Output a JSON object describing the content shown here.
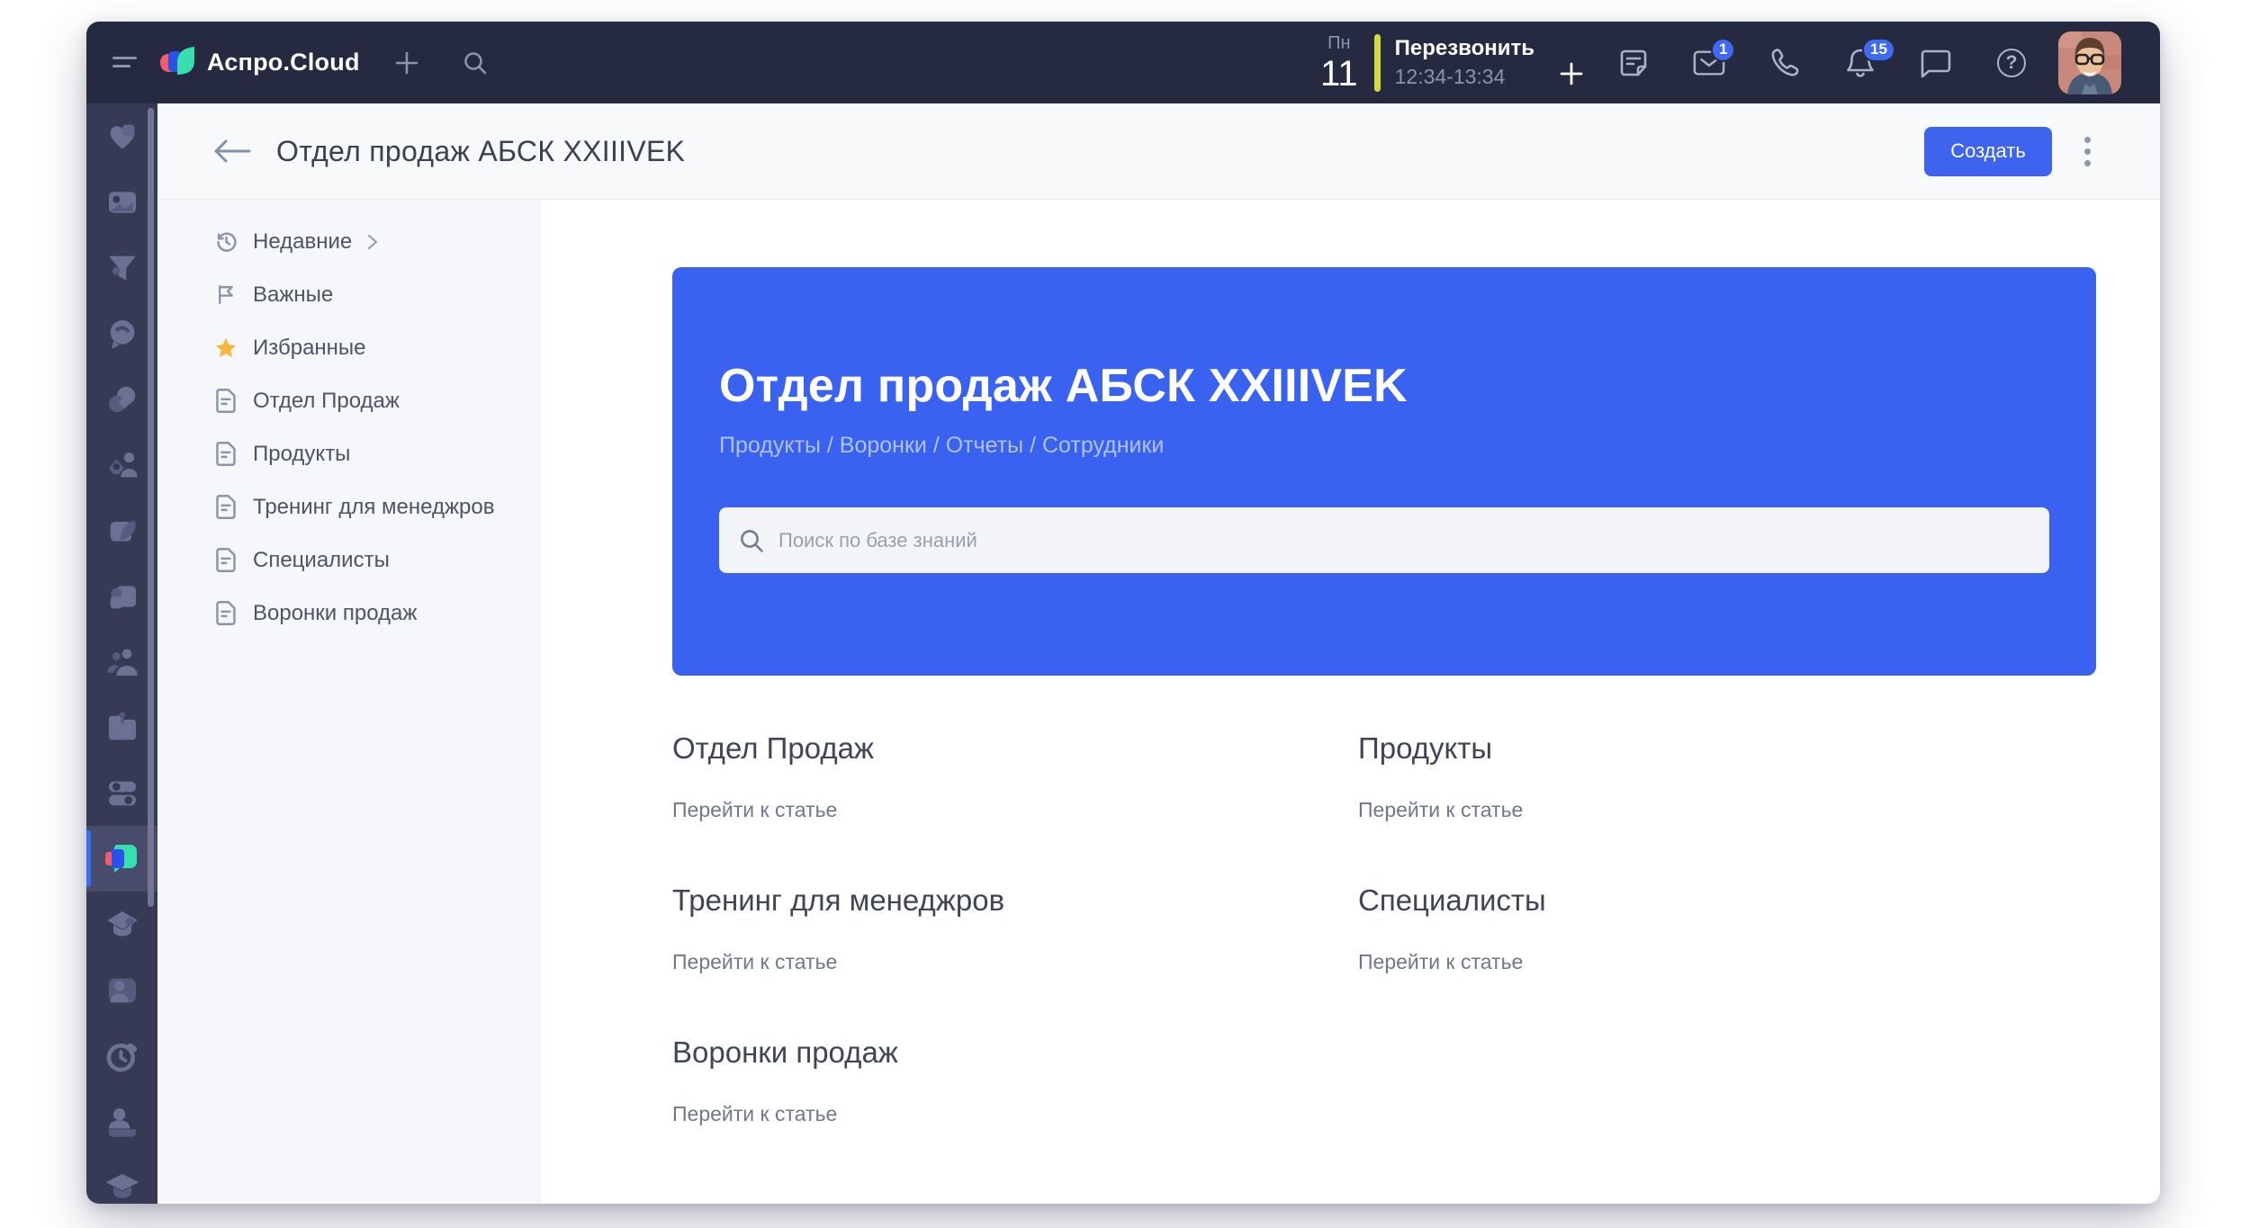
{
  "topbar": {
    "logo_text": "Аспро.Cloud",
    "date": {
      "day_name": "Пн",
      "day_num": "11"
    },
    "callback": {
      "title": "Перезвонить",
      "time": "12:34-13:34"
    },
    "badges": {
      "mail": "1",
      "notifications": "15"
    },
    "help_glyph": "?"
  },
  "page": {
    "title": "Отдел продаж АБСК XXIIIVEK",
    "create_button": "Создать"
  },
  "sidebar": {
    "items": [
      {
        "label": "Недавние"
      },
      {
        "label": "Важные"
      },
      {
        "label": "Избранные"
      },
      {
        "label": "Отдел Продаж"
      },
      {
        "label": "Продукты"
      },
      {
        "label": "Тренинг для менеджров"
      },
      {
        "label": "Специалисты"
      },
      {
        "label": "Воронки продаж"
      }
    ]
  },
  "hero": {
    "title": "Отдел продаж АБСК XXIIIVEK",
    "subtitle": "Продукты / Воронки / Отчеты / Сотрудники",
    "search_placeholder": "Поиск по базе знаний",
    "bg_color": "#3a62f0"
  },
  "articles": [
    {
      "title": "Отдел Продаж",
      "link": "Перейти к статье"
    },
    {
      "title": "Продукты",
      "link": "Перейти к статье"
    },
    {
      "title": "Тренинг для менеджров",
      "link": "Перейти к статье"
    },
    {
      "title": "Специалисты",
      "link": "Перейти к статье"
    },
    {
      "title": "Воронки продаж",
      "link": "Перейти к статье"
    }
  ],
  "colors": {
    "topbar_bg": "#262a40",
    "rail_bg": "#363a55",
    "accent_blue": "#3d63ef",
    "hero_blue": "#3a62f0",
    "badge_blue": "#3e6af2",
    "star_yellow": "#f6b73c",
    "calendar_bar_yellow": "#d5da43"
  }
}
